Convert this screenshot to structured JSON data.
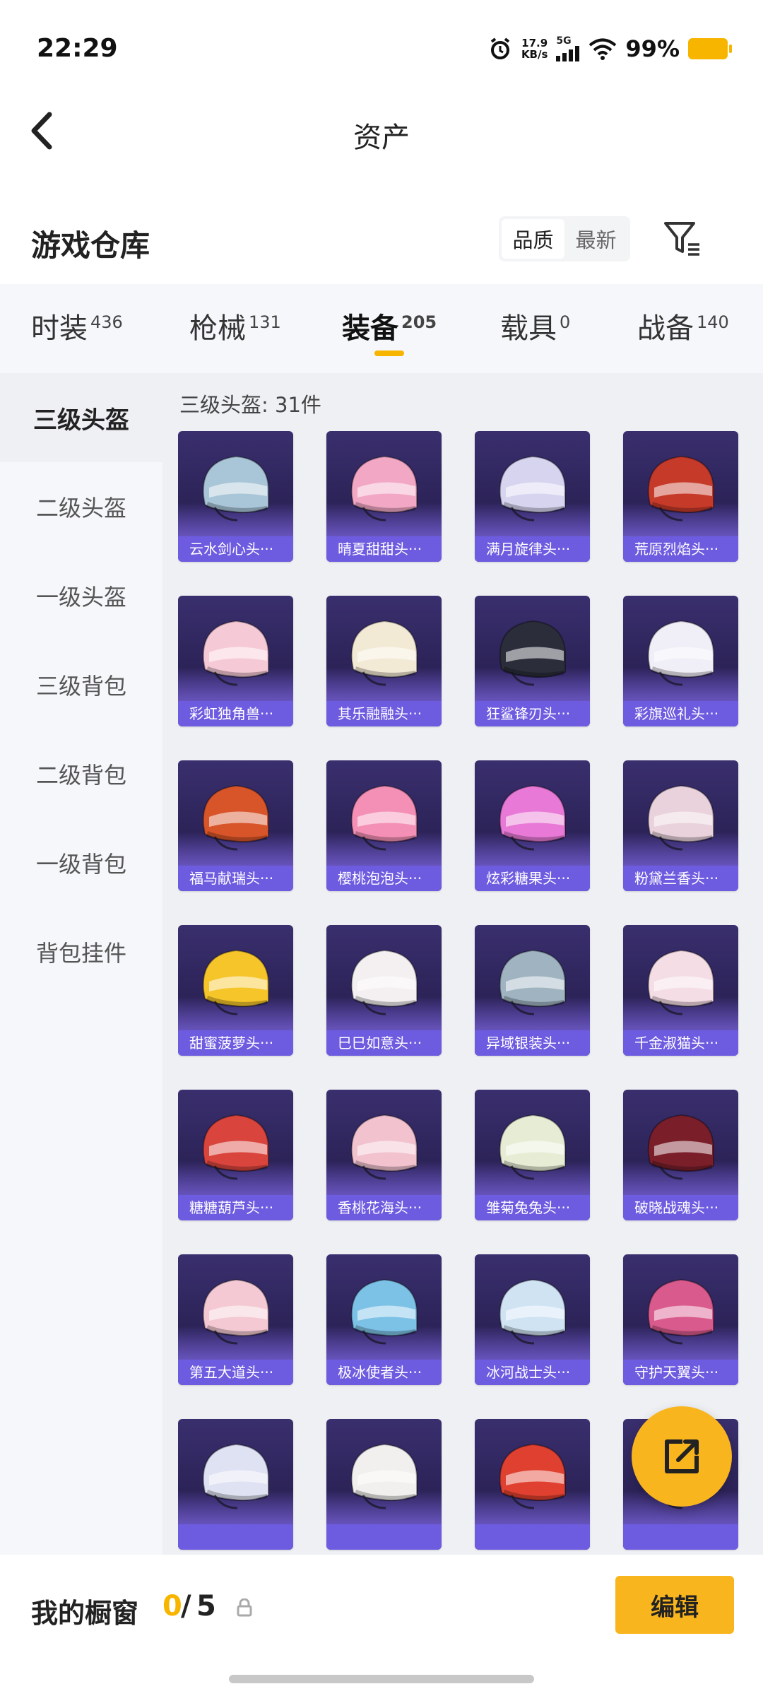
{
  "status_bar": {
    "time": "22:29",
    "net_speed_value": "17.9",
    "net_speed_unit": "KB/s",
    "signal": "5G",
    "battery": "99%"
  },
  "nav": {
    "title": "资产"
  },
  "header": {
    "title": "游戏仓库",
    "sort_options": [
      "品质",
      "最新"
    ],
    "sort_selected": "品质"
  },
  "tabs": [
    {
      "label": "时装",
      "count": "436"
    },
    {
      "label": "枪械",
      "count": "131"
    },
    {
      "label": "装备",
      "count": "205",
      "active": true
    },
    {
      "label": "载具",
      "count": "0"
    },
    {
      "label": "战备",
      "count": "140"
    }
  ],
  "sidebar": {
    "items": [
      "三级头盔",
      "二级头盔",
      "一级头盔",
      "三级背包",
      "二级背包",
      "一级背包",
      "背包挂件"
    ],
    "active": "三级头盔"
  },
  "grid": {
    "title": "三级头盔: 31件",
    "items": [
      {
        "name": "云水剑心头···",
        "color": "#a9c6d8"
      },
      {
        "name": "晴夏甜甜头···",
        "color": "#f2a7c4"
      },
      {
        "name": "满月旋律头···",
        "color": "#d7d4f0"
      },
      {
        "name": "荒原烈焰头···",
        "color": "#c63a2a"
      },
      {
        "name": "彩虹独角兽···",
        "color": "#f6c9d6"
      },
      {
        "name": "其乐融融头···",
        "color": "#f3ead6"
      },
      {
        "name": "狂鲨锋刃头···",
        "color": "#2b2e3a"
      },
      {
        "name": "彩旗巡礼头···",
        "color": "#f0eef6"
      },
      {
        "name": "福马献瑞头···",
        "color": "#d8552a"
      },
      {
        "name": "樱桃泡泡头···",
        "color": "#f48fb5"
      },
      {
        "name": "炫彩糖果头···",
        "color": "#e879d6"
      },
      {
        "name": "粉黛兰香头···",
        "color": "#e9d2dc"
      },
      {
        "name": "甜蜜菠萝头···",
        "color": "#f5c52a"
      },
      {
        "name": "巳巳如意头···",
        "color": "#f4f0f2"
      },
      {
        "name": "异域银装头···",
        "color": "#9fb3c0"
      },
      {
        "name": "千金淑猫头···",
        "color": "#f4dde4"
      },
      {
        "name": "糖糖葫芦头···",
        "color": "#d9453d"
      },
      {
        "name": "香桃花海头···",
        "color": "#f2c2cf"
      },
      {
        "name": "雏菊兔兔头···",
        "color": "#e7edd5"
      },
      {
        "name": "破晓战魂头···",
        "color": "#7a1f2a"
      },
      {
        "name": "第五大道头···",
        "color": "#f4c9d3"
      },
      {
        "name": "极冰使者头···",
        "color": "#7cc2e6"
      },
      {
        "name": "冰河战士头···",
        "color": "#cfe3f3"
      },
      {
        "name": "守护天翼头···",
        "color": "#d95a8c"
      },
      {
        "name": "",
        "color": "#dfe2f2"
      },
      {
        "name": "",
        "color": "#f1f0ee"
      },
      {
        "name": "",
        "color": "#e0402f"
      },
      {
        "name": "",
        "color": "#d83060"
      }
    ]
  },
  "bottom": {
    "label": "我的橱窗",
    "used": "0",
    "sep": "/",
    "total": "5",
    "edit_label": "编辑"
  }
}
